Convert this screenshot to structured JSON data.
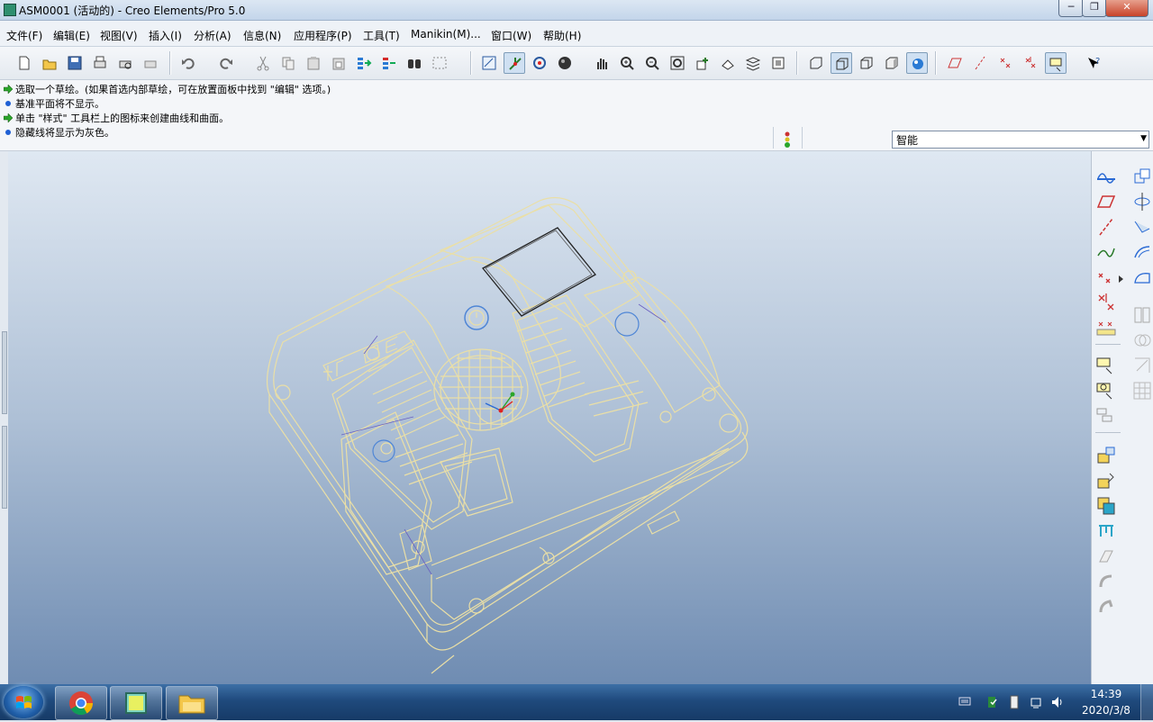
{
  "window": {
    "title": "ASM0001 (活动的) - Creo Elements/Pro 5.0",
    "minimize": "─",
    "maximize": "❐",
    "close": "✕"
  },
  "menu": [
    {
      "label": "文件(F)"
    },
    {
      "label": "编辑(E)"
    },
    {
      "label": "视图(V)"
    },
    {
      "label": "插入(I)"
    },
    {
      "label": "分析(A)"
    },
    {
      "label": "信息(N)"
    },
    {
      "label": "应用程序(P)"
    },
    {
      "label": "工具(T)"
    },
    {
      "label": "Manikin(M)..."
    },
    {
      "label": "窗口(W)"
    },
    {
      "label": "帮助(H)"
    }
  ],
  "toolbar": {
    "icons": [
      "new-icon",
      "open-icon",
      "save-icon",
      "print-icon",
      "print-preview-icon",
      "email-icon",
      "undo-icon",
      "redo-icon",
      "cut-icon",
      "copy-icon",
      "paste-icon",
      "paste-special-icon",
      "regenerate-icon",
      "regenerate-manager-icon",
      "find-icon",
      "select-box-icon",
      "redraw-icon",
      "spin-center-icon",
      "orient-mode-icon",
      "appearance-icon",
      "pan-icon",
      "zoom-in-icon",
      "zoom-out-icon",
      "refit-icon",
      "reorient-icon",
      "saved-views-icon",
      "layers-icon",
      "view-manager-icon",
      "wireframe-icon",
      "hidden-line-icon",
      "no-hidden-icon",
      "shading-icon",
      "enhanced-realism-icon",
      "datum-planes-icon",
      "datum-axes-icon",
      "datum-points-icon",
      "coord-systems-icon",
      "annotations-icon",
      "context-help-icon"
    ]
  },
  "messages": [
    {
      "type": "prompt",
      "text": "选取一个草绘。(如果首选内部草绘，可在放置面板中找到 \"编辑\" 选项。)"
    },
    {
      "type": "info",
      "text": "基准平面将不显示。"
    },
    {
      "type": "prompt",
      "text": "单击 \"样式\" 工具栏上的图标来创建曲线和曲面。"
    },
    {
      "type": "info",
      "text": "隐藏线将显示为灰色。"
    }
  ],
  "filter": {
    "value": "智能"
  },
  "taskbar": {
    "apps": [
      "chrome-icon",
      "creo-icon",
      "explorer-icon"
    ],
    "time": "14:39",
    "date": "2020/3/8"
  },
  "colors": {
    "viewport_top": "#dfe8f2",
    "viewport_bottom": "#6f8cb2",
    "wire": "#e8dca0"
  }
}
